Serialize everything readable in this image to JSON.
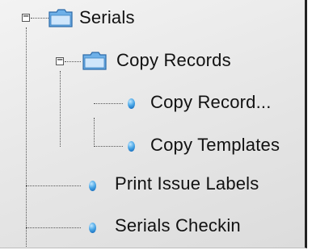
{
  "tree": {
    "root": {
      "label": "Serials",
      "expander": "−",
      "icon": "folder-icon"
    },
    "copy_records": {
      "label": "Copy Records",
      "expander": "−",
      "icon": "folder-icon",
      "children": [
        {
          "label": "Copy Record...",
          "icon": "leaf-bullet-icon"
        },
        {
          "label": "Copy Templates",
          "icon": "leaf-bullet-icon"
        }
      ]
    },
    "items": [
      {
        "label": "Print Issue Labels",
        "icon": "leaf-bullet-icon"
      },
      {
        "label": "Serials Checkin",
        "icon": "leaf-bullet-icon"
      }
    ]
  },
  "colors": {
    "background": "#e8e8e8",
    "bullet": "#1a7fd4",
    "folder": "#6eb0e8",
    "text": "#111111",
    "border": "#222222"
  }
}
